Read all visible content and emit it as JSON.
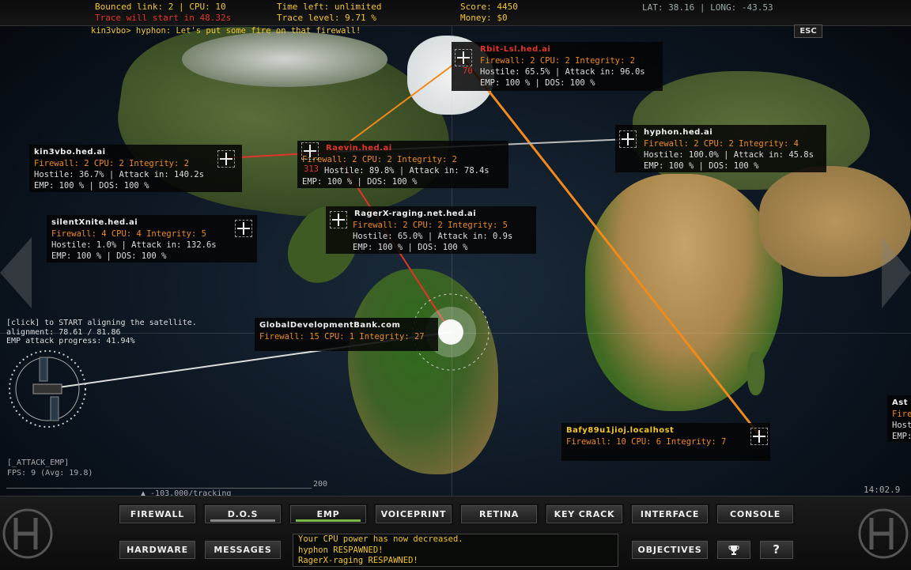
{
  "topbar": {
    "bounced_link": "Bounced link: 2 | CPU: 10",
    "trace_start": "Trace will start in 48.32s",
    "time_left": "Time left: unlimited",
    "trace_level": "Trace level: 9.71 %",
    "score": "Score: 4450",
    "money": "Money: $0",
    "coords": "LAT: 38.16 | LONG: -43.53",
    "chat": "kin3vbo> hyphon: Let's put some fire on that firewall!",
    "esc": "ESC"
  },
  "nodes": [
    {
      "name": "Rbit-Lsl.hed.ai",
      "name_color": "#e2352a",
      "l1": "Firewall: 2 CPU: 2 Integrity: 2",
      "l2": "Hostile: 65.5% | Attack in: 96.0s",
      "l3": "EMP: 100 % | DOS: 100 %",
      "num": "70"
    },
    {
      "name": "Raevin.hed.ai",
      "name_color": "#e2352a",
      "l1": "Firewall: 2 CPU: 2 Integrity: 2",
      "l2": "Hostile: 89.8% | Attack in: 78.4s",
      "l3": "EMP: 100 % | DOS: 100 %",
      "num": "313"
    },
    {
      "name": "kin3vbo.hed.ai",
      "name_color": "#eeeeee",
      "l1": "Firewall: 2 CPU: 2 Integrity: 2",
      "l2": "Hostile: 36.7% | Attack in: 140.2s",
      "l3": "EMP: 100 % | DOS: 100 %",
      "num": ""
    },
    {
      "name": "hyphon.hed.ai",
      "name_color": "#eeeeee",
      "l1": "Firewall: 2 CPU: 2 Integrity: 4",
      "l2": "Hostile: 100.0% | Attack in: 45.8s",
      "l3": "EMP: 100 % | DOS: 100 %",
      "num": ""
    },
    {
      "name": "silentXnite.hed.ai",
      "name_color": "#eeeeee",
      "l1": "Firewall: 4 CPU: 4 Integrity: 5",
      "l2": "Hostile: 1.0% | Attack in: 132.6s",
      "l3": "EMP: 100 % | DOS: 100 %",
      "num": ""
    },
    {
      "name": "RagerX-raging.net.hed.ai",
      "name_color": "#eeeeee",
      "l1": "Firewall: 2 CPU: 2 Integrity: 5",
      "l2": "Hostile: 65.0% | Attack in: 0.9s",
      "l3": "EMP: 100 % | DOS: 100 %",
      "num": ""
    },
    {
      "name": "GlobalDevelopmentBank.com",
      "name_color": "#eeeeee",
      "l1": "Firewall: 15 CPU: 1 Integrity: 27",
      "l2": "",
      "l3": "",
      "num": ""
    },
    {
      "name": "Bafy89u1jioj.localhost",
      "name_color": "#f3c623",
      "l1": "Firewall: 10 CPU: 6 Integrity: 7",
      "l2": "",
      "l3": "",
      "num": ""
    },
    {
      "name": "Ast",
      "name_color": "#eeeeee",
      "l1": "Fire",
      "l2": "Host",
      "l3": "EMP:",
      "num": ""
    }
  ],
  "satellite": {
    "line1": "[click] to START aligning the satellite.",
    "line2": "alignment: 78.61 / 81.86",
    "line3": "EMP attack progress: 41.94%"
  },
  "debug": {
    "attack": "[_ATTACK_EMP]",
    "fps": "FPS:   9 (Avg: 19.8)",
    "scale_max": "200",
    "tracking": "▲ -103.000/tracking",
    "clock": "14:02.9"
  },
  "buttons_row1": [
    "FIREWALL",
    "D.O.S",
    "EMP",
    "VOICEPRINT",
    "RETINA",
    "KEY CRACK",
    "INTERFACE",
    "CONSOLE"
  ],
  "buttons_row2": [
    "HARDWARE",
    "MESSAGES"
  ],
  "objectives": "OBJECTIVES",
  "trophy_icon": "trophy-icon",
  "help_label": "?",
  "messages": [
    "Your CPU power has now decreased.",
    "hyphon RESPAWNED!",
    "RagerX-raging RESPAWNED!"
  ],
  "colors": {
    "accent_yellow": "#f3c623",
    "alert_red": "#e2352a",
    "firewall_orange": "#f08a1a",
    "emp_green": "#7ab648"
  }
}
